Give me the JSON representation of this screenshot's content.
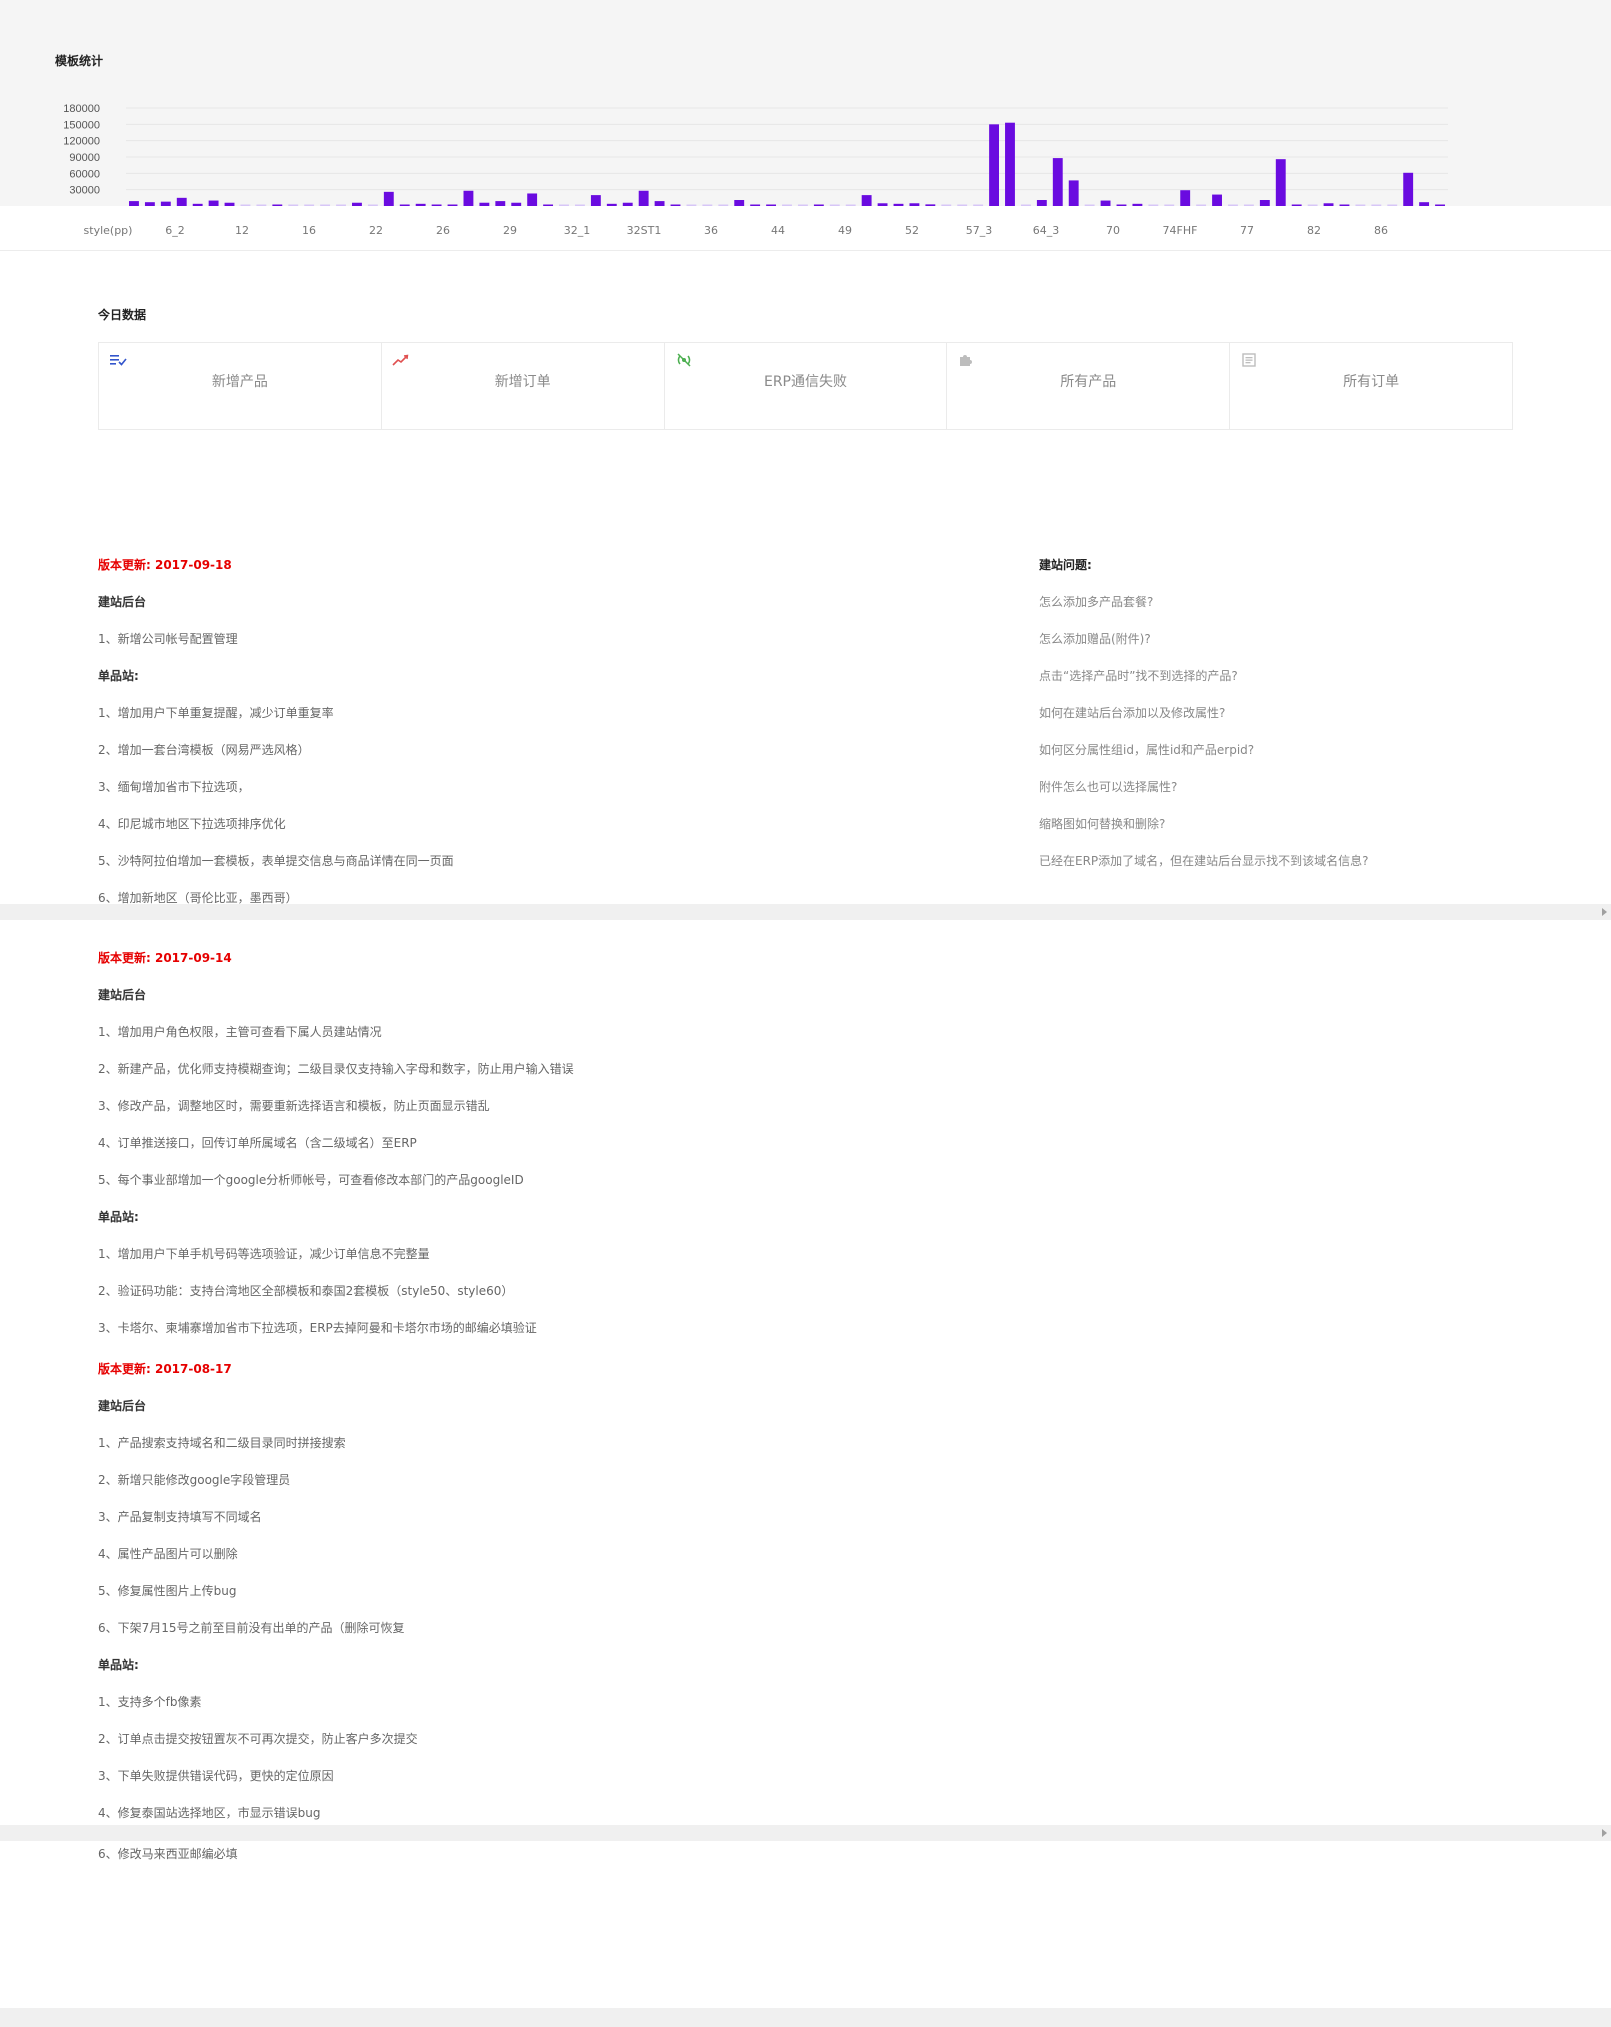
{
  "chart_section": {
    "title": "模板统计"
  },
  "chart_data": {
    "type": "bar",
    "title": "",
    "xlabel": "",
    "ylabel": "",
    "ylim": [
      0,
      180000
    ],
    "y_ticks": [
      30000,
      60000,
      90000,
      120000,
      150000,
      180000
    ],
    "grid": true,
    "bar_color": "#6a0be0",
    "x_tick_labels": [
      "style(pp)",
      "6_2",
      "12",
      "16",
      "22",
      "26",
      "29",
      "32_1",
      "32ST1",
      "36",
      "44",
      "49",
      "52",
      "57_3",
      "64_3",
      "70",
      "74FHF",
      "77",
      "82",
      "86"
    ],
    "values": [
      9000,
      7000,
      8000,
      15000,
      4000,
      10000,
      6000,
      0,
      0,
      1000,
      0,
      0,
      0,
      0,
      6000,
      0,
      26000,
      2000,
      4000,
      1000,
      1000,
      28000,
      6000,
      9000,
      6000,
      23000,
      2000,
      0,
      0,
      20000,
      4000,
      6000,
      28000,
      9000,
      1000,
      0,
      0,
      0,
      11000,
      2000,
      2000,
      0,
      0,
      1000,
      0,
      0,
      20000,
      5000,
      4000,
      5000,
      3000,
      0,
      0,
      0,
      150000,
      153000,
      0,
      11000,
      88000,
      47000,
      0,
      10000,
      1000,
      4000,
      0,
      0,
      29000,
      0,
      21000,
      0,
      0,
      11000,
      86000,
      2000,
      0,
      5000,
      2000,
      0,
      0,
      0,
      61000,
      7000,
      1000
    ]
  },
  "today": {
    "title": "今日数据",
    "cards": [
      {
        "label": "新增产品",
        "icon": "list-check-icon",
        "color": "#3355cc"
      },
      {
        "label": "新增订单",
        "icon": "trend-up-icon",
        "color": "#e05050"
      },
      {
        "label": "ERP通信失败",
        "icon": "signal-off-icon",
        "color": "#4caf50"
      },
      {
        "label": "所有产品",
        "icon": "puzzle-icon",
        "color": "#bdbdbd"
      },
      {
        "label": "所有订单",
        "icon": "document-icon",
        "color": "#bdbdbd"
      }
    ]
  },
  "updates": {
    "v1": {
      "title": "版本更新: 2017-09-18",
      "backend": "建站后台",
      "backend_items": [
        "1、新增公司帐号配置管理"
      ],
      "single": "单品站:",
      "single_items": [
        "1、增加用户下单重复提醒，减少订单重复率",
        "2、增加一套台湾模板（网易严选风格）",
        "3、缅甸增加省市下拉选项，",
        "4、印尼城市地区下拉选项排序优化",
        "5、沙特阿拉伯增加一套模板，表单提交信息与商品详情在同一页面",
        "6、增加新地区（哥伦比亚，墨西哥）"
      ]
    },
    "v2": {
      "title": "版本更新: 2017-09-14",
      "backend": "建站后台",
      "backend_items": [
        "1、增加用户角色权限，主管可查看下属人员建站情况",
        "2、新建产品，优化师支持模糊查询；二级目录仅支持输入字母和数字，防止用户输入错误",
        "3、修改产品，调整地区时，需要重新选择语言和模板，防止页面显示错乱",
        "4、订单推送接口，回传订单所属域名（含二级域名）至ERP",
        "5、每个事业部增加一个google分析师帐号，可查看修改本部门的产品googleID"
      ],
      "single": "单品站:",
      "single_items": [
        "1、增加用户下单手机号码等选项验证，减少订单信息不完整量",
        "2、验证码功能：支持台湾地区全部模板和泰国2套模板（style50、style60）",
        "3、卡塔尔、柬埔寨增加省市下拉选项，ERP去掉阿曼和卡塔尔市场的邮编必填验证"
      ]
    },
    "v3": {
      "title": "版本更新: 2017-08-17",
      "backend": "建站后台",
      "backend_items": [
        "1、产品搜索支持域名和二级目录同时拼接搜索",
        "2、新增只能修改google字段管理员",
        "3、产品复制支持填写不同域名",
        "4、属性产品图片可以删除",
        "5、修复属性图片上传bug",
        "6、下架7月15号之前至目前没有出单的产品（删除可恢复"
      ],
      "single": "单品站:",
      "single_items": [
        "1、支持多个fb像素",
        "2、订单点击提交按钮置灰不可再次提交，防止客户多次提交",
        "3、下单失败提供错误代码，更快的定位原因",
        "4、修复泰国站选择地区，市显示错误bug",
        "6、修改马来西亚邮编必填"
      ]
    }
  },
  "faq": {
    "title": "建站问题:",
    "items": [
      "怎么添加多产品套餐?",
      "怎么添加赠品(附件)?",
      "点击“选择产品时”找不到选择的产品?",
      "如何在建站后台添加以及修改属性?",
      "如何区分属性组id，属性id和产品erpid?",
      "附件怎么也可以选择属性?",
      "缩略图如何替换和删除?",
      "已经在ERP添加了域名，但在建站后台显示找不到该域名信息?"
    ]
  }
}
